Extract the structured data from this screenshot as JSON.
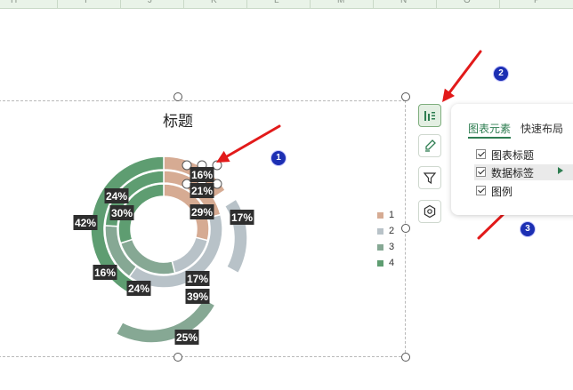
{
  "column_headers": [
    "H",
    "I",
    "J",
    "K",
    "L",
    "M",
    "N",
    "O",
    "P"
  ],
  "chart": {
    "title": "标题",
    "legend": [
      {
        "label": "1",
        "color": "#d6ab93"
      },
      {
        "label": "2",
        "color": "#b8c2c8"
      },
      {
        "label": "3",
        "color": "#86a894"
      },
      {
        "label": "4",
        "color": "#5e9d71"
      }
    ]
  },
  "chart_data": {
    "type": "doughnut",
    "title": "标题",
    "categories": [
      "1",
      "2",
      "3",
      "4"
    ],
    "series": [
      {
        "ring": "outer",
        "values": [
          16,
          17,
          25,
          42
        ],
        "labels": [
          "16%",
          "17%",
          "25%",
          "42%"
        ]
      },
      {
        "ring": "middle",
        "values": [
          21,
          39,
          16,
          24
        ],
        "labels": [
          "21%",
          "39%",
          "16%",
          "24%"
        ]
      },
      {
        "ring": "inner",
        "values": [
          29,
          17,
          24,
          30
        ],
        "labels": [
          "29%",
          "17%",
          "24%",
          "30%"
        ]
      }
    ],
    "legend_position": "right",
    "colors": [
      "#d6ab93",
      "#b8c2c8",
      "#86a894",
      "#5e9d71"
    ]
  },
  "side_tools": [
    {
      "name": "chart-elements-button",
      "icon": "chart-elements-icon",
      "active": true
    },
    {
      "name": "chart-style-button",
      "icon": "brush-icon",
      "active": false
    },
    {
      "name": "chart-filter-button",
      "icon": "filter-icon",
      "active": false
    },
    {
      "name": "chart-settings-button",
      "icon": "settings-icon",
      "active": false
    }
  ],
  "panel": {
    "tabs": [
      "图表元素",
      "快速布局"
    ],
    "active_tab": 0,
    "options": [
      {
        "label": "图表标题",
        "checked": true
      },
      {
        "label": "数据标签",
        "checked": true,
        "highlighted": true
      },
      {
        "label": "图例",
        "checked": true
      }
    ]
  },
  "annotations": {
    "step1": "1",
    "step2": "2",
    "step3": "3",
    "arrow_color": "#e21a1a",
    "badge_color": "#1c2fb3"
  }
}
